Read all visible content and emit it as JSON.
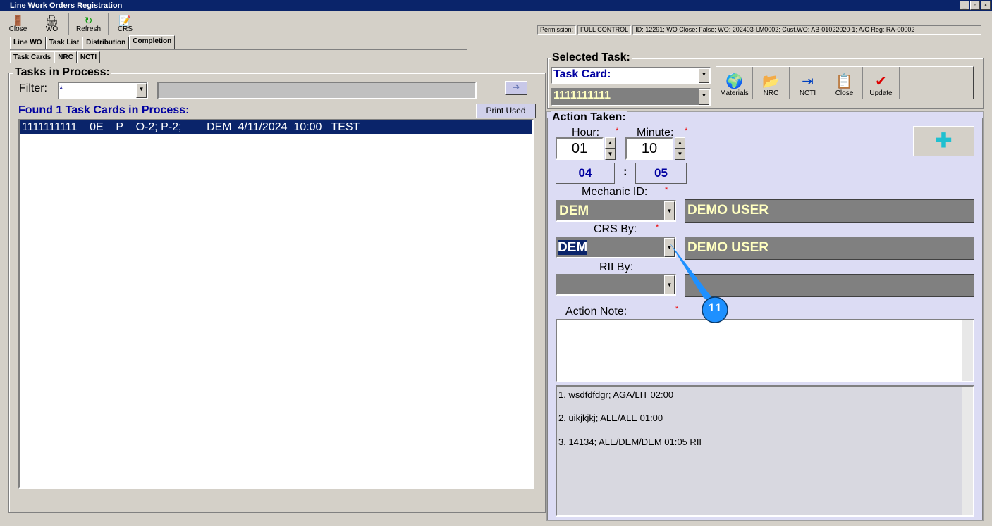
{
  "window": {
    "title": "Line Work Orders Registration"
  },
  "toolbar": [
    {
      "label": "Close",
      "icon": "door-exit-icon"
    },
    {
      "label": "WO",
      "icon": "printer-icon"
    },
    {
      "label": "Refresh",
      "icon": "refresh-icon"
    },
    {
      "label": "CRS",
      "icon": "document-edit-icon"
    }
  ],
  "status": {
    "permission_label": "Permission:",
    "permission": "FULL CONTROL",
    "info": "ID: 12291; WO Close: False; WO: 202403-LM0002; Cust.WO: AB-01022020-1; A/C Reg: RA-00002"
  },
  "tabs": [
    "Line WO",
    "Task List",
    "Distribution",
    "Completion"
  ],
  "subtabs": [
    "Task Cards",
    "NRC",
    "NCTI"
  ],
  "tasks": {
    "title": "Tasks in Process:",
    "filter_label": "Filter:",
    "filter_value": "*",
    "found": "Found 1 Task Cards in Process:",
    "print_used": "Print Used",
    "go_icon": "arrow-right-icon",
    "rows": [
      "1111111111    0E    P    O-2; P-2;        DEM  4/11/2024  10:00   TEST"
    ]
  },
  "selected": {
    "title": "Selected Task:",
    "type": "Task Card:",
    "card": "1111111111",
    "buttons": [
      {
        "label": "Materials",
        "icon": "globe-hand-icon"
      },
      {
        "label": "NRC",
        "icon": "folder-doc-icon"
      },
      {
        "label": "NCTI",
        "icon": "import-table-icon"
      },
      {
        "label": "Close",
        "icon": "close-doc-icon"
      },
      {
        "label": "Update",
        "icon": "clipboard-check-icon"
      }
    ]
  },
  "action": {
    "title": "Action Taken:",
    "hour_label": "Hour:",
    "minute_label": "Minute:",
    "hour": "01",
    "minute": "10",
    "total_h": "04",
    "sep": ":",
    "total_m": "05",
    "mechanic_label": "Mechanic ID:",
    "mechanic_id": "DEM",
    "mechanic_name": "DEMO USER",
    "crs_label": "CRS By:",
    "crs_id": "DEM",
    "crs_name": "DEMO USER",
    "rii_label": "RII By:",
    "note_label": "Action Note:",
    "req": "*",
    "history": [
      "1. wsdfdfdgr; AGA/LIT  02:00",
      "2. uikjkjkj; ALE/ALE  01:00",
      "3. 14134; ALE/DEM/DEM  01:05  RII"
    ]
  },
  "callout": {
    "number": "11",
    "color": "#1e90ff"
  }
}
